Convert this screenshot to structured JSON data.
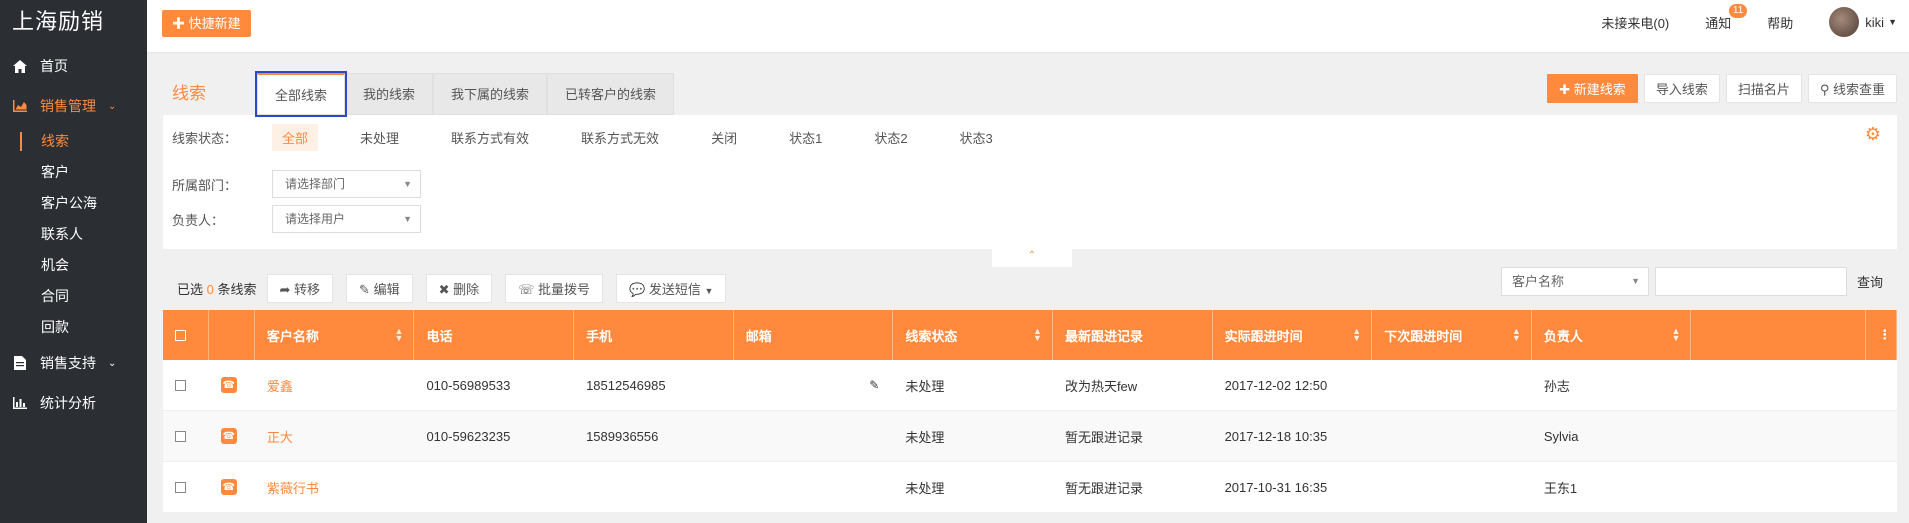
{
  "app": {
    "brand": "上海励销"
  },
  "sidebar": {
    "items": [
      {
        "label": "首页",
        "icon": "home-icon"
      },
      {
        "label": "销售管理",
        "icon": "chart-area-icon",
        "expanded": true,
        "children": [
          "线索",
          "客户",
          "客户公海",
          "联系人",
          "机会",
          "合同",
          "回款"
        ],
        "active_child": "线索"
      },
      {
        "label": "销售支持",
        "icon": "document-icon"
      },
      {
        "label": "统计分析",
        "icon": "bar-chart-icon"
      }
    ]
  },
  "topbar": {
    "quick_new": "快捷新建",
    "missed_calls": "未接来电(0)",
    "notify": "通知",
    "notify_count": "11",
    "help": "帮助",
    "user": "kiki"
  },
  "panel": {
    "title": "线索",
    "tabs": [
      "全部线索",
      "我的线索",
      "我下属的线索",
      "已转客户的线索"
    ],
    "active_tab": "全部线索",
    "actions": {
      "new": "新建线索",
      "import": "导入线索",
      "scan": "扫描名片",
      "dedupe": "线索查重"
    }
  },
  "filters": {
    "status_label": "线索状态：",
    "status_options": [
      "全部",
      "未处理",
      "联系方式有效",
      "联系方式无效",
      "关闭",
      "状态1",
      "状态2",
      "状态3"
    ],
    "dept_label": "所属部门：",
    "dept_placeholder": "请选择部门",
    "owner_label": "负责人：",
    "owner_placeholder": "请选择用户"
  },
  "toolbar": {
    "selected_prefix": "已选",
    "selected_count": "0",
    "selected_suffix": "条线索",
    "transfer": "转移",
    "edit": "编辑",
    "delete": "删除",
    "batch_dial": "批量拨号",
    "send_sms": "发送短信",
    "search_field": "客户名称",
    "search_btn": "查询"
  },
  "table": {
    "columns": [
      "客户名称",
      "电话",
      "手机",
      "邮箱",
      "线索状态",
      "最新跟进记录",
      "实际跟进时间",
      "下次跟进时间",
      "负责人"
    ],
    "rows": [
      {
        "name": "爱鑫",
        "phone": "010-56989533",
        "mobile": "18512546985",
        "email": "",
        "status": "未处理",
        "latest": "改为热天few",
        "actual_time": "2017-12-02 12:50",
        "next_time": "",
        "owner": "孙志"
      },
      {
        "name": "正大",
        "phone": "010-59623235",
        "mobile": "1589936556",
        "email": "",
        "status": "未处理",
        "latest": "暂无跟进记录",
        "actual_time": "2017-12-18 10:35",
        "next_time": "",
        "owner": "Sylvia"
      },
      {
        "name": "紫薇行书",
        "phone": "",
        "mobile": "",
        "email": "",
        "status": "未处理",
        "latest": "暂无跟进记录",
        "actual_time": "2017-10-31 16:35",
        "next_time": "",
        "owner": "王东1"
      }
    ]
  },
  "colors": {
    "accent": "#ff8a3d",
    "sidebar_bg": "#2b2e33",
    "tab_highlight": "#2a48c9"
  }
}
